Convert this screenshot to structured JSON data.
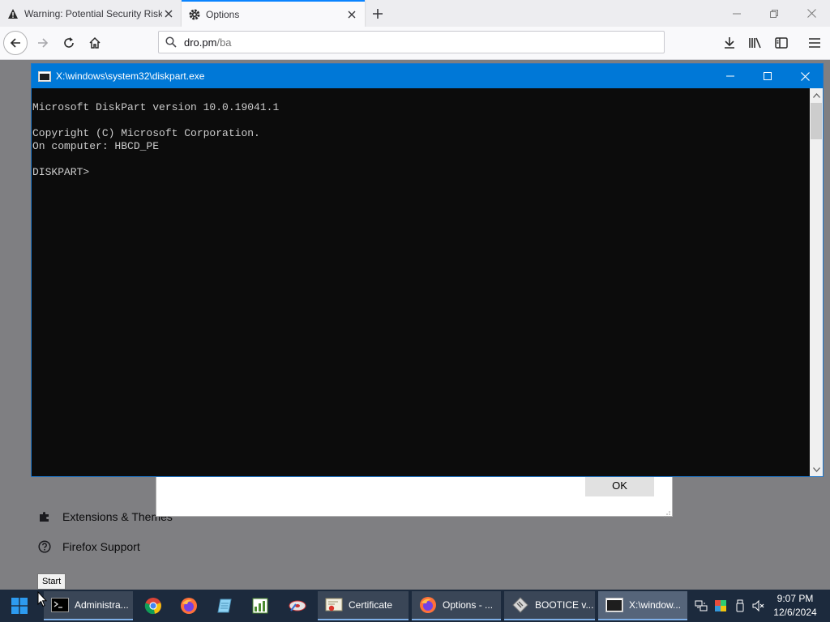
{
  "browser": {
    "tabs": [
      {
        "title": "Warning: Potential Security Risk Ahead",
        "icon": "warning-icon",
        "active": false
      },
      {
        "title": "Options",
        "icon": "gear-icon",
        "active": true
      }
    ],
    "url_host": "dro.pm",
    "url_path": "/ba"
  },
  "options_page": {
    "extensions_label": "Extensions & Themes",
    "support_label": "Firefox Support",
    "dialog_ok_label": "OK"
  },
  "console": {
    "title": "X:\\windows\\system32\\diskpart.exe",
    "lines": [
      "Microsoft DiskPart version 10.0.19041.1",
      "",
      "Copyright (C) Microsoft Corporation.",
      "On computer: HBCD_PE",
      "",
      "DISKPART> "
    ]
  },
  "tooltip": "Start",
  "taskbar": {
    "items": [
      {
        "label": "Administra...",
        "icon": "cmd-icon"
      },
      {
        "label": "Certificate",
        "icon": "certificate-icon"
      },
      {
        "label": "Options - ...",
        "icon": "firefox-icon"
      },
      {
        "label": "BOOTICE v...",
        "icon": "bootice-icon"
      },
      {
        "label": "X:\\window...",
        "icon": "console-icon"
      }
    ],
    "pinned": [
      "chrome-icon",
      "firefox-icon",
      "notepad-icon",
      "spreadsheet-icon",
      "disk-tool-icon"
    ],
    "clock_time": "9:07 PM",
    "clock_date": "12/6/2024"
  },
  "colors": {
    "console_title_bg": "#0078d7",
    "console_bg": "#0c0c0c",
    "console_text": "#cccccc",
    "taskbar_bg": "#1c2a3d",
    "active_tab_accent": "#0a84ff"
  }
}
